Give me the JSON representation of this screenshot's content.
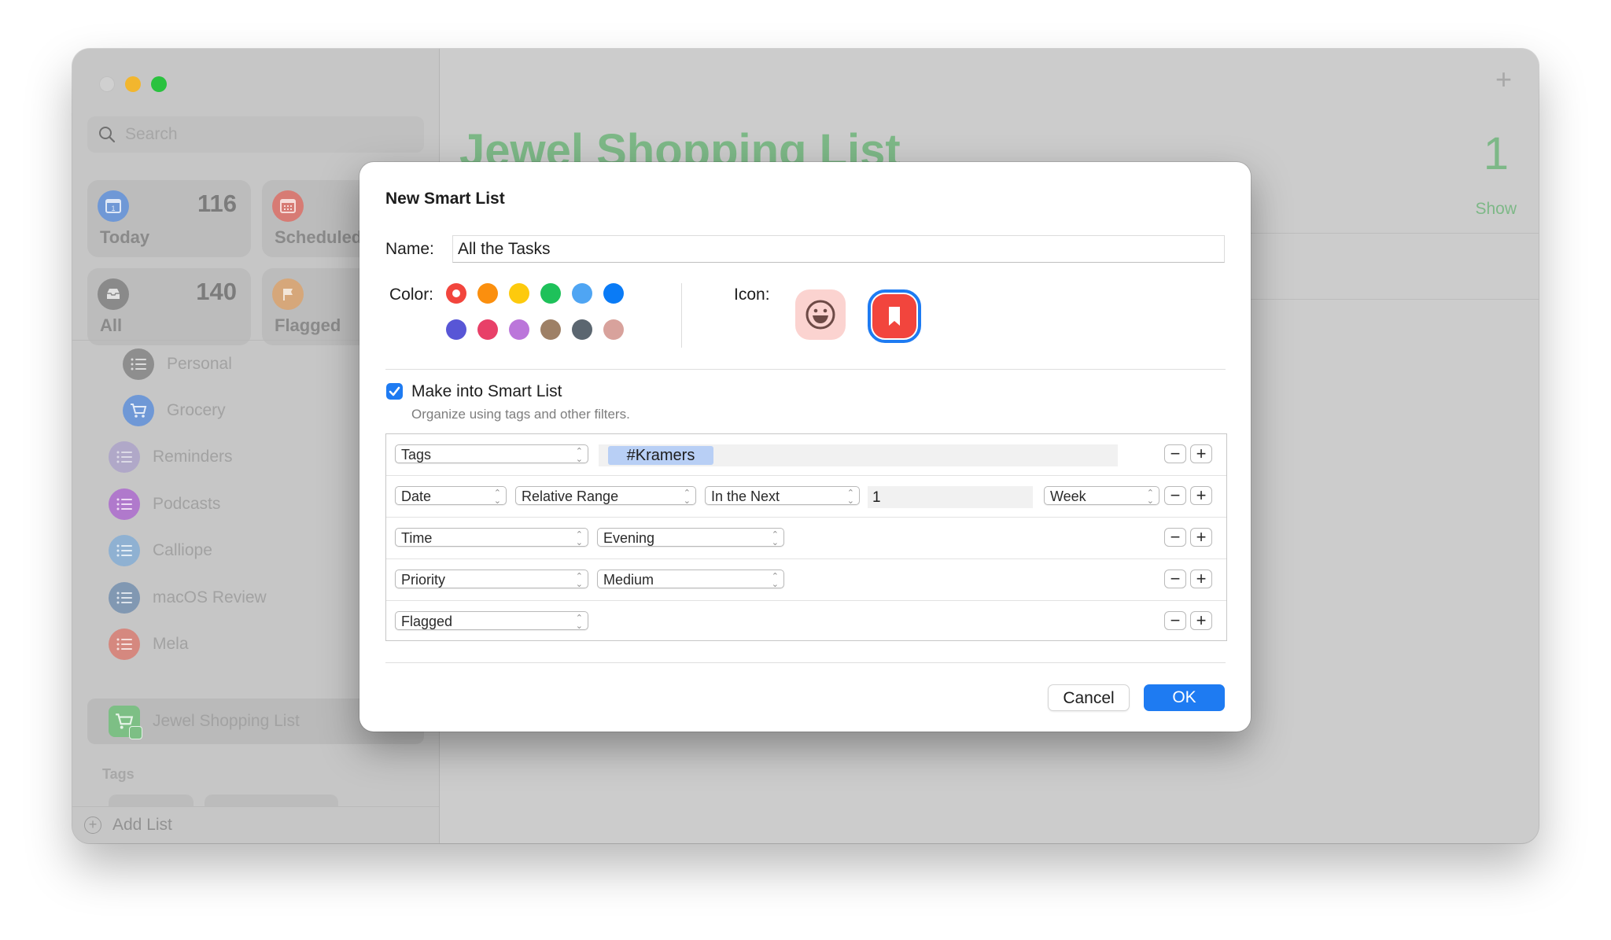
{
  "window": {
    "traffic_lights": [
      "close",
      "minimize",
      "zoom"
    ]
  },
  "sidebar": {
    "search_placeholder": "Search",
    "smart_cards": [
      {
        "label": "Today",
        "count": "116",
        "icon": "calendar-today-icon",
        "color": "#6f98d6"
      },
      {
        "label": "Scheduled",
        "count": "",
        "icon": "calendar-grid-icon",
        "color": "#d77b74"
      },
      {
        "label": "All",
        "count": "140",
        "icon": "tray-icon",
        "color": "#8a8a8a"
      },
      {
        "label": "Flagged",
        "count": "",
        "icon": "flag-icon",
        "color": "#d6a77a"
      }
    ],
    "lists": [
      {
        "label": "Personal",
        "icon": "list-icon",
        "color": "#8e8e8e",
        "indent": true
      },
      {
        "label": "Grocery",
        "icon": "cart-icon",
        "color": "#6f98d6",
        "indent": true
      },
      {
        "label": "Reminders",
        "icon": "list-icon",
        "color": "#b0a8c8",
        "indent": false
      },
      {
        "label": "Podcasts",
        "icon": "list-icon",
        "color": "#b079cc",
        "indent": false
      },
      {
        "label": "Calliope",
        "icon": "list-icon",
        "color": "#8fb1d2",
        "indent": false
      },
      {
        "label": "macOS Review",
        "icon": "list-icon",
        "color": "#8198b2",
        "indent": false
      },
      {
        "label": "Mela",
        "icon": "list-icon",
        "color": "#d5887f",
        "indent": false
      },
      {
        "label": "Jewel Shopping List",
        "icon": "smart-cart-icon",
        "color": "#7dbf85",
        "indent": false,
        "selected": true
      }
    ],
    "tags_heading": "Tags",
    "add_list_label": "Add List"
  },
  "main": {
    "title": "Jewel Shopping List",
    "count": "1",
    "show_label": "Show",
    "accent": "#7db887"
  },
  "dialog": {
    "title": "New Smart List",
    "name_label": "Name:",
    "name_value": "All the Tasks",
    "color_label": "Color:",
    "colors": [
      "#f2453d",
      "#fb8f0e",
      "#fdca0d",
      "#1ec15a",
      "#4fa5f3",
      "#0a7bf6",
      "#5856d6",
      "#e84068",
      "#bb76da",
      "#9e8066",
      "#5b6670",
      "#d8a29c"
    ],
    "selected_color_index": 0,
    "icon_label": "Icon:",
    "icons": [
      {
        "name": "smiley-icon",
        "selected": false
      },
      {
        "name": "bookmark-icon",
        "selected": true
      }
    ],
    "smart_checkbox_label": "Make into Smart List",
    "smart_checkbox_checked": true,
    "smart_checkbox_sub": "Organize using tags and other filters.",
    "rules": [
      {
        "field": "Tags",
        "token": "#Kramers"
      },
      {
        "field": "Date",
        "mode": "Relative Range",
        "range": "In the Next",
        "amount": "1",
        "unit": "Week"
      },
      {
        "field": "Time",
        "value": "Evening"
      },
      {
        "field": "Priority",
        "value": "Medium"
      },
      {
        "field": "Flagged"
      }
    ],
    "remove_symbol": "−",
    "add_symbol": "+",
    "cancel_label": "Cancel",
    "ok_label": "OK"
  }
}
